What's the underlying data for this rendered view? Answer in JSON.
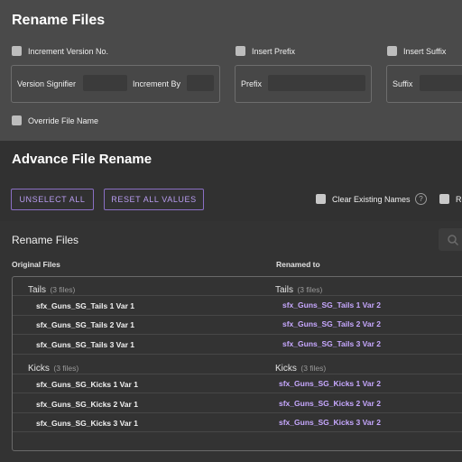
{
  "header": {
    "title": "Rename Files"
  },
  "options": {
    "increment_version": "Increment Version No.",
    "insert_prefix": "Insert Prefix",
    "insert_suffix": "Insert Suffix",
    "version_signifier": "Version Signifier",
    "increment_by": "Increment By",
    "prefix": "Prefix",
    "suffix": "Suffix",
    "override_file_name": "Override File Name"
  },
  "advance": {
    "title": "Advance File Rename",
    "unselect_all": "UNSELECT ALL",
    "reset_all_values": "RESET ALL VALUES",
    "clear_existing_names": "Clear Existing Names",
    "help": "?",
    "cut_label": "Re"
  },
  "files": {
    "title": "Rename Files",
    "col_original": "Original Files",
    "col_renamed": "Renamed to",
    "groups": [
      {
        "name": "Tails",
        "count": "(3 files)",
        "items": [
          {
            "original": "sfx_Guns_SG_Tails 1 Var 1",
            "renamed": "sfx_Guns_SG_Tails 1 Var 2"
          },
          {
            "original": "sfx_Guns_SG_Tails 2 Var 1",
            "renamed": "sfx_Guns_SG_Tails 2 Var 2"
          },
          {
            "original": "sfx_Guns_SG_Tails 3 Var 1",
            "renamed": "sfx_Guns_SG_Tails 3 Var 2"
          }
        ]
      },
      {
        "name": "Kicks",
        "count": "(3 files)",
        "items": [
          {
            "original": "sfx_Guns_SG_Kicks 1 Var 1",
            "renamed": "sfx_Guns_SG_Kicks 1 Var 2"
          },
          {
            "original": "sfx_Guns_SG_Kicks 2 Var 1",
            "renamed": "sfx_Guns_SG_Kicks 2 Var 2"
          },
          {
            "original": "sfx_Guns_SG_Kicks 3 Var 1",
            "renamed": "sfx_Guns_SG_Kicks 3 Var 2"
          }
        ]
      }
    ]
  }
}
